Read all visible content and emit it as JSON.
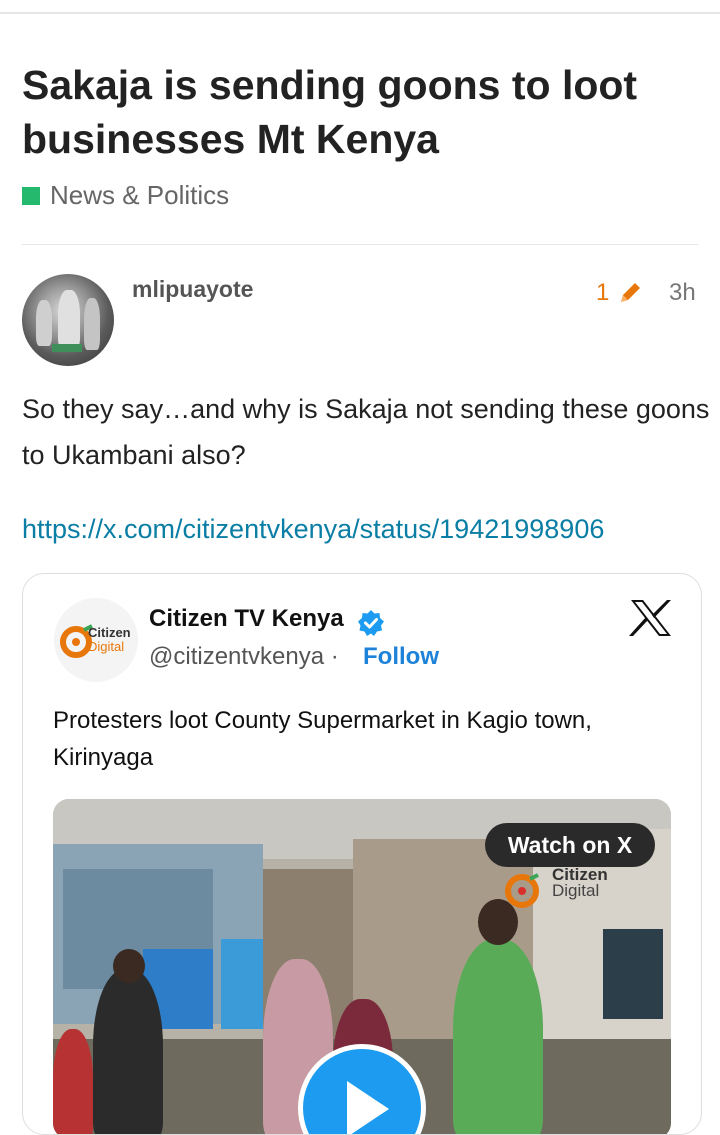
{
  "topic": {
    "title": "Sakaja is sending goons to loot businesses Mt Kenya",
    "category": {
      "label": "News & Politics",
      "color": "#25b96d"
    }
  },
  "post": {
    "username": "mlipuayote",
    "edit_count": "1",
    "time_ago": "3h",
    "body": "So they say…and why is Sakaja not sending these goons to Ukambani also?",
    "link": "https://x.com/citizentvkenya/status/19421998906"
  },
  "embed": {
    "account_name": "Citizen TV Kenya",
    "handle": "@citizentvkenya",
    "separator": " · ",
    "follow_label": "Follow",
    "logo_text_1": "Citizen",
    "logo_text_2": "Digital",
    "tweet_text": "Protesters loot County Supermarket in Kagio town, Kirinyaga",
    "watch_label": "Watch on X",
    "watermark_1": "Citizen",
    "watermark_2": "Digital"
  },
  "colors": {
    "accent_orange": "#e8770b",
    "link_blue": "#0a7ea4",
    "follow_blue": "#1d82d8"
  },
  "icons": [
    "pencil-icon",
    "verified-badge-icon",
    "x-logo-icon",
    "play-icon"
  ]
}
